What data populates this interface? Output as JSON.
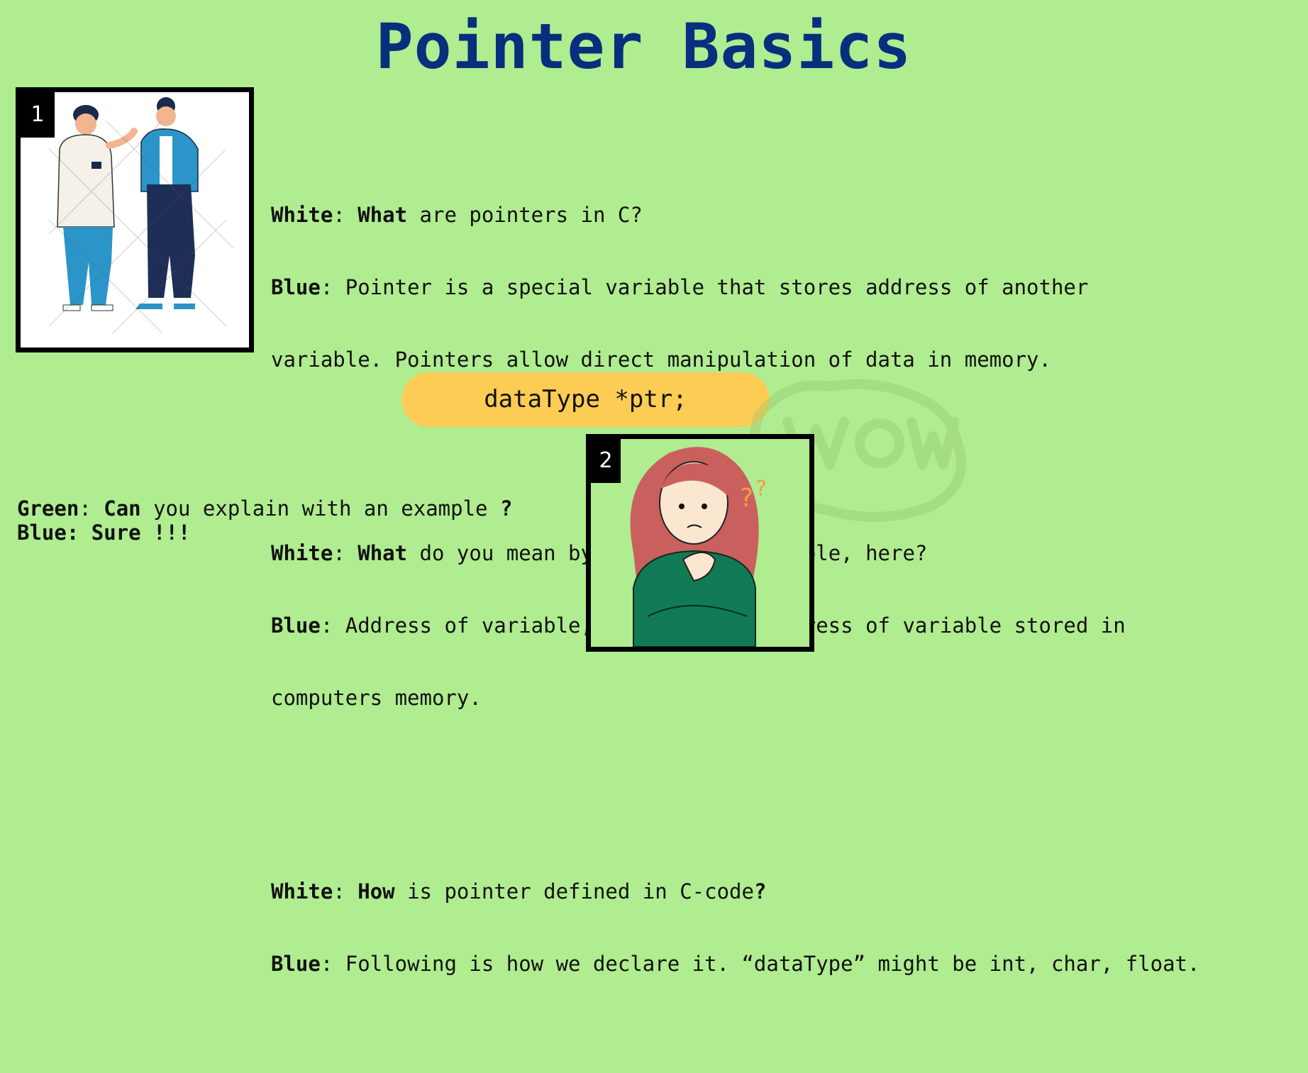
{
  "title": "Pointer Basics",
  "panel1": {
    "number": "1"
  },
  "panel2": {
    "number": "2"
  },
  "dialog": [
    {
      "q_speaker": "White",
      "q_sep": ": ",
      "q_keyword": "What",
      "q_rest": " are pointers in C?",
      "a_speaker": "Blue",
      "a_sep": ": ",
      "a_line1": "Pointer is a special variable that stores address of another",
      "a_line2": "variable. Pointers allow direct manipulation of data in memory."
    },
    {
      "q_speaker": "White",
      "q_sep": ": ",
      "q_keyword": "What",
      "q_rest": " do you mean by address of variable, here?",
      "a_speaker": "Blue",
      "a_sep": ": ",
      "a_line1": "Address of variable, i.e., memory address of variable stored in",
      "a_line2": "computers memory."
    },
    {
      "q_speaker": "White",
      "q_sep": ": ",
      "q_keyword": "How",
      "q_rest": " is pointer defined in C-code",
      "q_end": "?",
      "a_speaker": "Blue",
      "a_sep": ": ",
      "a_line1": "Following is how we declare it. “dataType” might be int, char, float."
    }
  ],
  "code_snippet": "dataType *ptr;",
  "bottom_dialog": {
    "q_speaker": "Green",
    "q_sep": ": ",
    "q_keyword": "Can",
    "q_rest": " you explain with an example ",
    "q_end": "?",
    "a_line": "Blue: Sure !!!"
  },
  "colors": {
    "background": "#b0ec90",
    "title": "#062f7e",
    "code_pill": "#fdcc55"
  },
  "icons": {
    "panel1": "two-men-talking-illustration",
    "panel2": "confused-woman-illustration",
    "stamp": "wow-sticker-watermark"
  }
}
